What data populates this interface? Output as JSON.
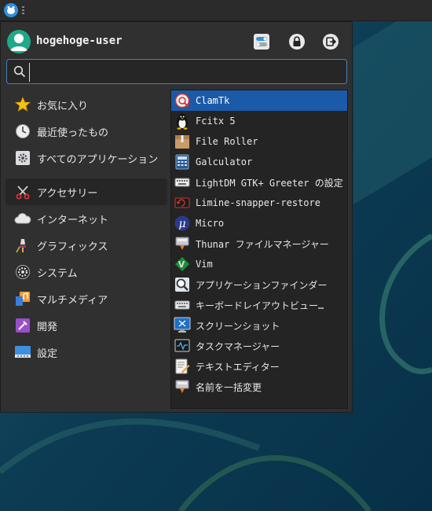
{
  "user": {
    "name": "hogehoge-user"
  },
  "search": {
    "value": "",
    "placeholder": ""
  },
  "categories": [
    {
      "label": "お気に入り",
      "icon": "star-icon"
    },
    {
      "label": "最近使ったもの",
      "icon": "clock-icon"
    },
    {
      "label": "すべてのアプリケーション",
      "icon": "gear-icon"
    },
    {
      "label": "アクセサリー",
      "icon": "scissors-icon",
      "selected": true
    },
    {
      "label": "インターネット",
      "icon": "cloud-icon"
    },
    {
      "label": "グラフィックス",
      "icon": "paint-icon"
    },
    {
      "label": "システム",
      "icon": "system-gear-icon"
    },
    {
      "label": "マルチメディア",
      "icon": "music-icon"
    },
    {
      "label": "開発",
      "icon": "dev-tools-icon"
    },
    {
      "label": "設定",
      "icon": "settings-icon"
    }
  ],
  "apps": [
    {
      "label": "ClamTk",
      "icon": "clamtk-icon",
      "selected": true
    },
    {
      "label": "Fcitx 5",
      "icon": "penguin-icon"
    },
    {
      "label": "File Roller",
      "icon": "archive-icon"
    },
    {
      "label": "Galculator",
      "icon": "calculator-icon"
    },
    {
      "label": "LightDM GTK+ Greeter の設定",
      "icon": "keyboard-settings-icon"
    },
    {
      "label": "Limine-snapper-restore",
      "icon": "restore-icon"
    },
    {
      "label": "Micro",
      "icon": "micro-icon"
    },
    {
      "label": "Thunar ファイルマネージャー",
      "icon": "file-manager-icon"
    },
    {
      "label": "Vim",
      "icon": "vim-icon"
    },
    {
      "label": "アプリケーションファインダー",
      "icon": "app-finder-icon"
    },
    {
      "label": "キーボードレイアウトビュー…",
      "icon": "keyboard-icon"
    },
    {
      "label": "スクリーンショット",
      "icon": "screenshot-icon"
    },
    {
      "label": "タスクマネージャー",
      "icon": "task-manager-icon"
    },
    {
      "label": "テキストエディター",
      "icon": "text-editor-icon"
    },
    {
      "label": "名前を一括変更",
      "icon": "bulk-rename-icon"
    }
  ],
  "colors": {
    "accent": "#1b5aa8",
    "search_border": "#4a7fb8",
    "desktop": "#0d3a4e",
    "menu_bg": "#303030"
  }
}
